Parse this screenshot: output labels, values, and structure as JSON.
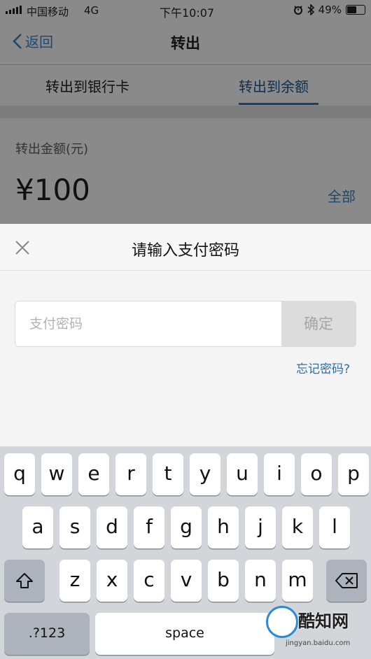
{
  "status_bar": {
    "carrier": "中国移动",
    "network": "4G",
    "time": "下午10:07",
    "battery_percent": "49%",
    "battery_level": 0.49,
    "icons": [
      "signal-icon",
      "alarm-icon",
      "bluetooth-icon",
      "battery-icon"
    ]
  },
  "navbar": {
    "back_label": "返回",
    "title": "转出"
  },
  "tabs": [
    {
      "label": "转出到银行卡",
      "selected": false
    },
    {
      "label": "转出到余额",
      "selected": true
    }
  ],
  "amount": {
    "label": "转出金额(元)",
    "value": "¥100",
    "all_label": "全部"
  },
  "payment_sheet": {
    "title": "请输入支付密码",
    "password_placeholder": "支付密码",
    "confirm_label": "确定",
    "forgot_label": "忘记密码?"
  },
  "keyboard": {
    "row1": [
      "q",
      "w",
      "e",
      "r",
      "t",
      "y",
      "u",
      "i",
      "o",
      "p"
    ],
    "row2": [
      "a",
      "s",
      "d",
      "f",
      "g",
      "h",
      "j",
      "k",
      "l"
    ],
    "row3": [
      "z",
      "x",
      "c",
      "v",
      "b",
      "n",
      "m"
    ],
    "numbers_label": ".?123",
    "space_label": "space"
  },
  "watermark": {
    "name": "酷知网",
    "url": "jingyan.baidu.com"
  },
  "colors": {
    "accent": "#21486b",
    "link": "#2c6ea8",
    "keyboard_bg": "#d2d5da"
  }
}
